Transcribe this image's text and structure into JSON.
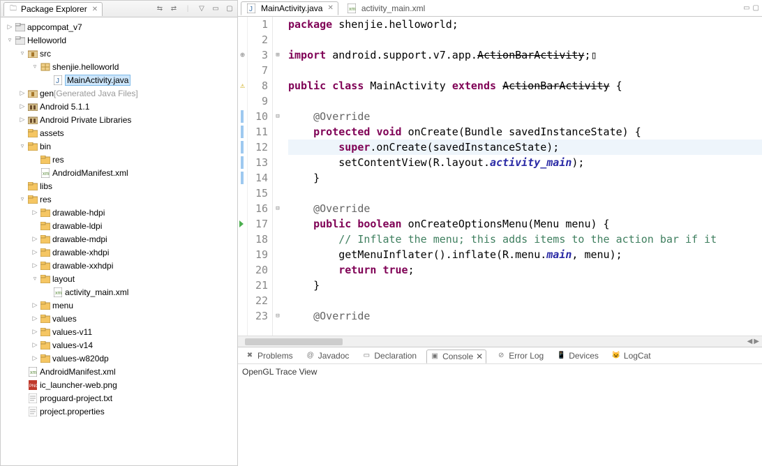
{
  "left_panel": {
    "title": "Package Explorer",
    "tree": [
      {
        "level": 0,
        "exp": "▷",
        "icon": "folder-black",
        "label": "appcompat_v7"
      },
      {
        "level": 0,
        "exp": "▿",
        "icon": "folder-black",
        "label": "Helloworld"
      },
      {
        "level": 1,
        "exp": "▿",
        "icon": "src-folder",
        "label": "src"
      },
      {
        "level": 2,
        "exp": "▿",
        "icon": "pkg",
        "label": "shenjie.helloworld"
      },
      {
        "level": 3,
        "exp": "",
        "icon": "jfile",
        "label": "MainActivity.java",
        "selected": true
      },
      {
        "level": 1,
        "exp": "▷",
        "icon": "src-folder",
        "label": "gen",
        "suffix": "[Generated Java Files]",
        "gray": true
      },
      {
        "level": 1,
        "exp": "▷",
        "icon": "lib-folder",
        "label": "Android 5.1.1"
      },
      {
        "level": 1,
        "exp": "▷",
        "icon": "lib-folder",
        "label": "Android Private Libraries"
      },
      {
        "level": 1,
        "exp": "",
        "icon": "folder",
        "label": "assets"
      },
      {
        "level": 1,
        "exp": "▿",
        "icon": "folder",
        "label": "bin"
      },
      {
        "level": 2,
        "exp": "",
        "icon": "folder",
        "label": "res"
      },
      {
        "level": 2,
        "exp": "",
        "icon": "xmlfile",
        "label": "AndroidManifest.xml"
      },
      {
        "level": 1,
        "exp": "",
        "icon": "folder",
        "label": "libs"
      },
      {
        "level": 1,
        "exp": "▿",
        "icon": "folder",
        "label": "res"
      },
      {
        "level": 2,
        "exp": "▷",
        "icon": "folder",
        "label": "drawable-hdpi"
      },
      {
        "level": 2,
        "exp": "",
        "icon": "folder",
        "label": "drawable-ldpi"
      },
      {
        "level": 2,
        "exp": "▷",
        "icon": "folder",
        "label": "drawable-mdpi"
      },
      {
        "level": 2,
        "exp": "▷",
        "icon": "folder",
        "label": "drawable-xhdpi"
      },
      {
        "level": 2,
        "exp": "▷",
        "icon": "folder",
        "label": "drawable-xxhdpi"
      },
      {
        "level": 2,
        "exp": "▿",
        "icon": "folder",
        "label": "layout"
      },
      {
        "level": 3,
        "exp": "",
        "icon": "xmlfile",
        "label": "activity_main.xml"
      },
      {
        "level": 2,
        "exp": "▷",
        "icon": "folder",
        "label": "menu"
      },
      {
        "level": 2,
        "exp": "▷",
        "icon": "folder",
        "label": "values"
      },
      {
        "level": 2,
        "exp": "▷",
        "icon": "folder",
        "label": "values-v11"
      },
      {
        "level": 2,
        "exp": "▷",
        "icon": "folder",
        "label": "values-v14"
      },
      {
        "level": 2,
        "exp": "▷",
        "icon": "folder",
        "label": "values-w820dp"
      },
      {
        "level": 1,
        "exp": "",
        "icon": "xmlfile",
        "label": "AndroidManifest.xml"
      },
      {
        "level": 1,
        "exp": "",
        "icon": "pngfile",
        "label": "ic_launcher-web.png"
      },
      {
        "level": 1,
        "exp": "",
        "icon": "txtfile",
        "label": "proguard-project.txt"
      },
      {
        "level": 1,
        "exp": "",
        "icon": "txtfile",
        "label": "project.properties"
      }
    ]
  },
  "editor": {
    "tabs": [
      {
        "label": "MainActivity.java",
        "icon": "jfile",
        "active": true
      },
      {
        "label": "activity_main.xml",
        "icon": "xmlfile",
        "active": false
      }
    ],
    "lines": [
      {
        "n": 1,
        "ann": "",
        "fold": "",
        "html": "<span class='kw'>package</span> shenjie.helloworld;"
      },
      {
        "n": 2,
        "ann": "",
        "fold": "",
        "html": ""
      },
      {
        "n": 3,
        "ann": "⊕",
        "fold": "⊞",
        "html": "<span class='kw'>import</span> android.support.v7.app.<span class='strike'>ActionBarActivity</span>;▯"
      },
      {
        "n": 7,
        "ann": "",
        "fold": "",
        "html": ""
      },
      {
        "n": 8,
        "ann": "⚠",
        "fold": "",
        "html": "<span class='kw'>public</span> <span class='kw'>class</span> MainActivity <span class='kw'>extends</span> <span class='strike'>ActionBarActivity</span> {"
      },
      {
        "n": 9,
        "ann": "",
        "fold": "",
        "html": ""
      },
      {
        "n": 10,
        "ann": "bar",
        "fold": "⊟",
        "html": "    <span class='ann'>@Override</span>"
      },
      {
        "n": 11,
        "ann": "bar",
        "fold": "",
        "html": "    <span class='kw'>protected</span> <span class='kw'>void</span> onCreate(Bundle savedInstanceState) {"
      },
      {
        "n": 12,
        "ann": "bar",
        "fold": "",
        "html": "        <span class='kw'>super</span>.onCreate(savedInstanceState);",
        "hl": true
      },
      {
        "n": 13,
        "ann": "bar",
        "fold": "",
        "html": "        setContentView(R.layout.<span class='field-italic'>activity_main</span>);"
      },
      {
        "n": 14,
        "ann": "bar",
        "fold": "",
        "html": "    }"
      },
      {
        "n": 15,
        "ann": "",
        "fold": "",
        "html": ""
      },
      {
        "n": 16,
        "ann": "",
        "fold": "⊟",
        "html": "    <span class='ann'>@Override</span>"
      },
      {
        "n": 17,
        "ann": "▲",
        "fold": "",
        "html": "    <span class='kw'>public</span> <span class='kw'>boolean</span> onCreateOptionsMenu(Menu menu) {"
      },
      {
        "n": 18,
        "ann": "",
        "fold": "",
        "html": "        <span class='comment'>// Inflate the menu; this adds items to the action bar if it</span>"
      },
      {
        "n": 19,
        "ann": "",
        "fold": "",
        "html": "        getMenuInflater().inflate(R.menu.<span class='field-italic'>main</span>, menu);"
      },
      {
        "n": 20,
        "ann": "",
        "fold": "",
        "html": "        <span class='kw'>return</span> <span class='kw'>true</span>;"
      },
      {
        "n": 21,
        "ann": "",
        "fold": "",
        "html": "    }"
      },
      {
        "n": 22,
        "ann": "",
        "fold": "",
        "html": ""
      },
      {
        "n": 23,
        "ann": "",
        "fold": "⊟",
        "html": "    <span class='ann'>@Override</span>"
      }
    ]
  },
  "bottom": {
    "tabs": [
      {
        "label": "Problems",
        "icon": "✖"
      },
      {
        "label": "Javadoc",
        "icon": "@"
      },
      {
        "label": "Declaration",
        "icon": "▭"
      },
      {
        "label": "Console",
        "icon": "▣",
        "active": true
      },
      {
        "label": "Error Log",
        "icon": "⊘"
      },
      {
        "label": "Devices",
        "icon": "📱"
      },
      {
        "label": "LogCat",
        "icon": "😺"
      }
    ],
    "body": "OpenGL Trace View"
  }
}
